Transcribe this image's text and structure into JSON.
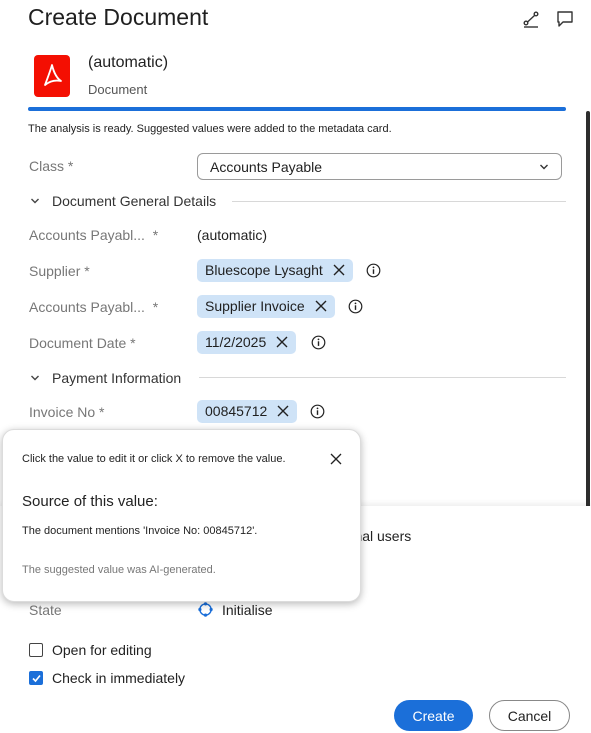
{
  "header": {
    "title": "Create Document"
  },
  "document": {
    "name": "(automatic)",
    "type": "Document"
  },
  "analysis_message": "The analysis is ready. Suggested values were added to the metadata card.",
  "class_field": {
    "label": "Class",
    "required_mark": "*",
    "value": "Accounts Payable"
  },
  "sections": {
    "general": "Document General Details",
    "payment": "Payment Information"
  },
  "fields": {
    "ap_number": {
      "label": "Accounts Payabl...",
      "required_mark": "*",
      "value": "(automatic)"
    },
    "supplier": {
      "label": "Supplier *",
      "value": "Bluescope Lysaght"
    },
    "ap_type": {
      "label": "Accounts Payabl...",
      "required_mark": "*",
      "value": "Supplier Invoice"
    },
    "document_date": {
      "label": "Document Date *",
      "value": "11/2/2025"
    },
    "invoice_no": {
      "label": "Invoice No *",
      "value": "00845712"
    }
  },
  "popover": {
    "hint": "Click the value to edit it or click X to remove the value.",
    "heading": "Source of this value:",
    "body": "The document mentions 'Invoice No: 00845712'.",
    "footer": "The suggested value was AI-generated."
  },
  "partial_text": "ernal users",
  "state": {
    "label": "State",
    "value": "Initialise"
  },
  "options": {
    "open_for_editing": {
      "label": "Open for editing",
      "checked": false
    },
    "check_in": {
      "label": "Check in immediately",
      "checked": true
    }
  },
  "buttons": {
    "create": "Create",
    "cancel": "Cancel"
  },
  "colors": {
    "accent": "#1b6fd9",
    "chip": "#cfe3f7",
    "pdf_red": "#f40f02"
  }
}
